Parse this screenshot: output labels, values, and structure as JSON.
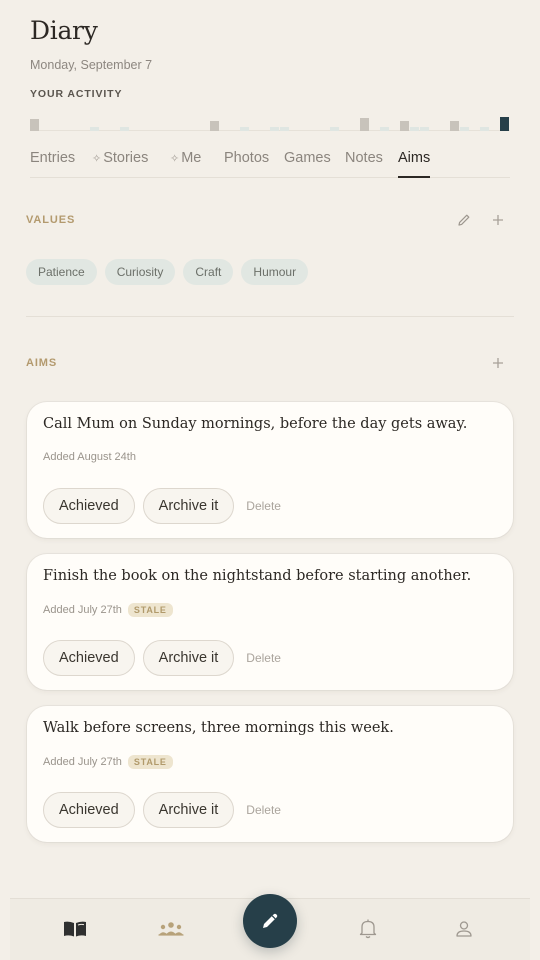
{
  "header": {
    "title": "Diary",
    "date": "Monday, September 7",
    "activity_label": "YOUR ACTIVITY"
  },
  "activity": {
    "levels": [
      0.55,
      0,
      0,
      0,
      0,
      0,
      0.2,
      0,
      0,
      0.2,
      0,
      0,
      0,
      0,
      0,
      0,
      0,
      0,
      0.45,
      0,
      0,
      0.2,
      0,
      0,
      0.2,
      0.2,
      0,
      0,
      0,
      0,
      0.2,
      0,
      0,
      0.6,
      0,
      0.2,
      0,
      0.45,
      0.2,
      0.2,
      0,
      0,
      0.45,
      0.2,
      0,
      0.2,
      0,
      0.62
    ],
    "colors": {
      "bar": "#c8c3bb",
      "bar_light": "#dfe6e2",
      "bar_today": "#263f49"
    }
  },
  "tabs": [
    {
      "label": "Entries",
      "spark": false,
      "active": false
    },
    {
      "label": "Stories",
      "spark": true,
      "active": false
    },
    {
      "label": "Me",
      "spark": true,
      "active": false
    },
    {
      "label": "Photos",
      "spark": false,
      "active": false
    },
    {
      "label": "Games",
      "spark": false,
      "active": false
    },
    {
      "label": "Notes",
      "spark": false,
      "active": false
    },
    {
      "label": "Aims",
      "spark": false,
      "active": true
    }
  ],
  "values_section": {
    "label": "VALUES",
    "edit_icon": "pencil-icon",
    "add_icon": "plus-icon",
    "chips": [
      "Patience",
      "Curiosity",
      "Craft",
      "Humour"
    ]
  },
  "aims_section": {
    "label": "AIMS",
    "add_icon": "plus-icon",
    "items": [
      {
        "text": "Call Mum on Sunday mornings, before the day gets away.",
        "added": "Added August 24th",
        "stale": ""
      },
      {
        "text": "Finish the book on the nightstand before starting another.",
        "added": "Added July 27th",
        "stale": "STALE"
      },
      {
        "text": "Walk before screens, three mornings this week.",
        "added": "Added July 27th",
        "stale": "STALE"
      }
    ],
    "actions": {
      "achieved": "Achieved",
      "archive": "Archive it",
      "delete": "Delete"
    }
  },
  "bottom_nav": {
    "items": [
      "journal-icon",
      "people-icon",
      "compose-icon",
      "bell-icon",
      "profile-icon"
    ],
    "active": "journal-icon"
  },
  "colors": {
    "background": "#f3efe8",
    "accent": "#263f49",
    "label_gold": "#b39a6e",
    "chip_bg": "#e1e7e2"
  }
}
